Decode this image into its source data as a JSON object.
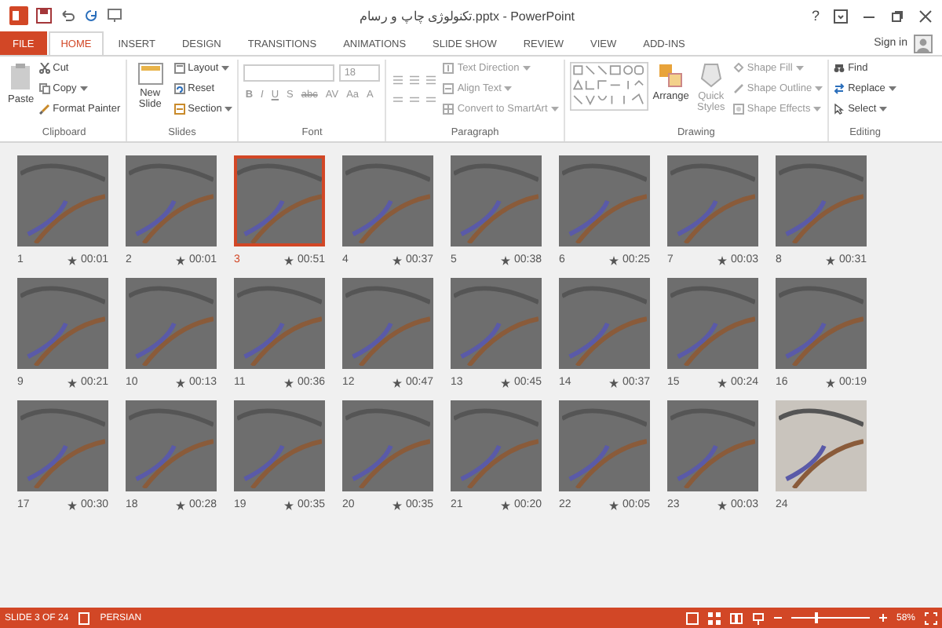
{
  "window": {
    "title": "تکنولوژی چاپ و رسام.pptx - PowerPoint",
    "help": "?"
  },
  "tabs": [
    {
      "label": "FILE",
      "kind": "file",
      "selected": false
    },
    {
      "label": "HOME",
      "kind": "tab",
      "selected": true
    },
    {
      "label": "INSERT",
      "kind": "tab",
      "selected": false
    },
    {
      "label": "DESIGN",
      "kind": "tab",
      "selected": false
    },
    {
      "label": "TRANSITIONS",
      "kind": "tab",
      "selected": false
    },
    {
      "label": "ANIMATIONS",
      "kind": "tab",
      "selected": false
    },
    {
      "label": "SLIDE SHOW",
      "kind": "tab",
      "selected": false
    },
    {
      "label": "REVIEW",
      "kind": "tab",
      "selected": false
    },
    {
      "label": "VIEW",
      "kind": "tab",
      "selected": false
    },
    {
      "label": "ADD-INS",
      "kind": "tab",
      "selected": false
    }
  ],
  "sign_in": "Sign in",
  "ribbon": {
    "clipboard": {
      "label": "Clipboard",
      "paste": "Paste",
      "cut": "Cut",
      "copy": "Copy",
      "format_painter": "Format Painter"
    },
    "slides": {
      "label": "Slides",
      "new_slide": "New Slide",
      "layout": "Layout",
      "reset": "Reset",
      "section": "Section"
    },
    "font": {
      "label": "Font",
      "size": "18",
      "styles": [
        "B",
        "I",
        "U",
        "S",
        "abc",
        "AV",
        "Aa",
        "A"
      ]
    },
    "paragraph": {
      "label": "Paragraph",
      "text_direction": "Text Direction",
      "align_text": "Align Text",
      "convert": "Convert to SmartArt"
    },
    "drawing": {
      "label": "Drawing",
      "arrange": "Arrange",
      "quick_styles": "Quick Styles",
      "shape_fill": "Shape Fill",
      "shape_outline": "Shape Outline",
      "shape_effects": "Shape Effects"
    },
    "editing": {
      "label": "Editing",
      "find": "Find",
      "replace": "Replace",
      "select": "Select"
    }
  },
  "slides": [
    {
      "number": "1",
      "time": "00:01",
      "selected": false
    },
    {
      "number": "2",
      "time": "00:01",
      "selected": false
    },
    {
      "number": "3",
      "time": "00:51",
      "selected": true
    },
    {
      "number": "4",
      "time": "00:37",
      "selected": false
    },
    {
      "number": "5",
      "time": "00:38",
      "selected": false
    },
    {
      "number": "6",
      "time": "00:25",
      "selected": false
    },
    {
      "number": "7",
      "time": "00:03",
      "selected": false
    },
    {
      "number": "8",
      "time": "00:31",
      "selected": false
    },
    {
      "number": "9",
      "time": "00:21",
      "selected": false
    },
    {
      "number": "10",
      "time": "00:13",
      "selected": false
    },
    {
      "number": "11",
      "time": "00:36",
      "selected": false
    },
    {
      "number": "12",
      "time": "00:47",
      "selected": false
    },
    {
      "number": "13",
      "time": "00:45",
      "selected": false
    },
    {
      "number": "14",
      "time": "00:37",
      "selected": false
    },
    {
      "number": "15",
      "time": "00:24",
      "selected": false
    },
    {
      "number": "16",
      "time": "00:19",
      "selected": false
    },
    {
      "number": "17",
      "time": "00:30",
      "selected": false
    },
    {
      "number": "18",
      "time": "00:28",
      "selected": false
    },
    {
      "number": "19",
      "time": "00:35",
      "selected": false
    },
    {
      "number": "20",
      "time": "00:35",
      "selected": false
    },
    {
      "number": "21",
      "time": "00:20",
      "selected": false
    },
    {
      "number": "22",
      "time": "00:05",
      "selected": false
    },
    {
      "number": "23",
      "time": "00:03",
      "selected": false
    },
    {
      "number": "24",
      "selected": false
    }
  ],
  "status_bar": {
    "slide": "SLIDE 3 OF 24",
    "language": "PERSIAN",
    "zoom": "58%",
    "level": 0.3
  }
}
